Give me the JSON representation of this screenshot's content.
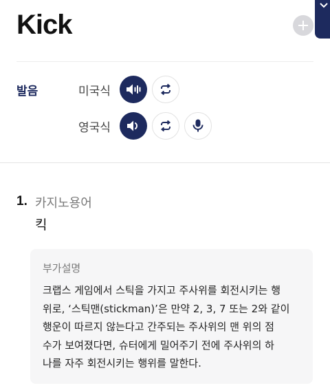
{
  "header": {
    "word": "Kick",
    "add_icon": "plus-icon",
    "bookmark_icon": "chevron-down-icon"
  },
  "pronunciation": {
    "label": "발음",
    "rows": [
      {
        "name": "미국식",
        "buttons": [
          "speaker-icon",
          "repeat-icon"
        ]
      },
      {
        "name": "영국식",
        "buttons": [
          "speaker-icon",
          "repeat-icon",
          "microphone-icon"
        ]
      }
    ]
  },
  "definition": {
    "number": "1.",
    "category": "카지노용어",
    "meaning": "킥"
  },
  "note": {
    "title": "부가설명",
    "lines": [
      "크랩스 게임에서 스틱을 가지고 주사위를 회전시키는 행",
      "위로, ‘스틱맨(stickman)’은 만약 2, 3, 7 또는 2와 같이",
      "행운이 따르지 않는다고 간주되는 주사위의 맨 위의 점",
      "수가 보여졌다면, 슈터에게 밀어주기 전에 주사위의 하",
      "나를 자주 회전시키는 행위를 말한다."
    ]
  },
  "colors": {
    "accent": "#1d2a5e",
    "add_button": "#d8d8dc",
    "note_background": "#f6f6f7"
  }
}
